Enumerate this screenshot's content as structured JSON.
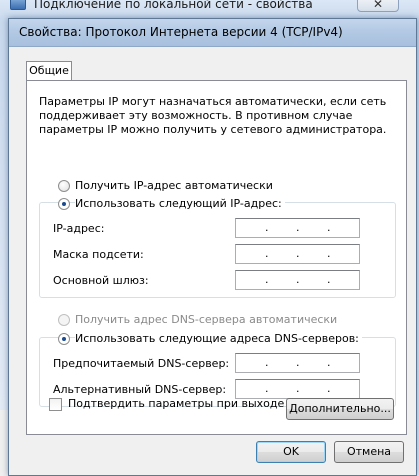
{
  "background_window": {
    "title": "Подключение по локальной сети - свойства",
    "close_label": "✕"
  },
  "dialog": {
    "title": "Свойства: Протокол Интернета версии 4 (TCP/IPv4)",
    "tabs": [
      {
        "label": "Общие"
      }
    ],
    "description": "Параметры IP могут назначаться автоматически, если сеть поддерживает эту возможность. В противном случае параметры IP можно получить у сетевого администратора.",
    "ip_section": {
      "auto_label": "Получить IP-адрес автоматически",
      "manual_label": "Использовать следующий IP-адрес:",
      "selected": "manual",
      "fields": [
        {
          "label": "IP-адрес:",
          "value": ""
        },
        {
          "label": "Маска подсети:",
          "value": ""
        },
        {
          "label": "Основной шлюз:",
          "value": ""
        }
      ]
    },
    "dns_section": {
      "auto_label": "Получить адрес DNS-сервера автоматически",
      "manual_label": "Использовать следующие адреса DNS-серверов:",
      "selected": "manual",
      "fields": [
        {
          "label": "Предпочитаемый DNS-сервер:",
          "value": ""
        },
        {
          "label": "Альтернативный DNS-сервер:",
          "value": ""
        }
      ]
    },
    "validate_label": "Подтвердить параметры при выходе",
    "validate_checked": false,
    "advanced_label": "Дополнительно...",
    "ok_label": "OK",
    "cancel_label": "Отмена",
    "ip_separator": "."
  }
}
